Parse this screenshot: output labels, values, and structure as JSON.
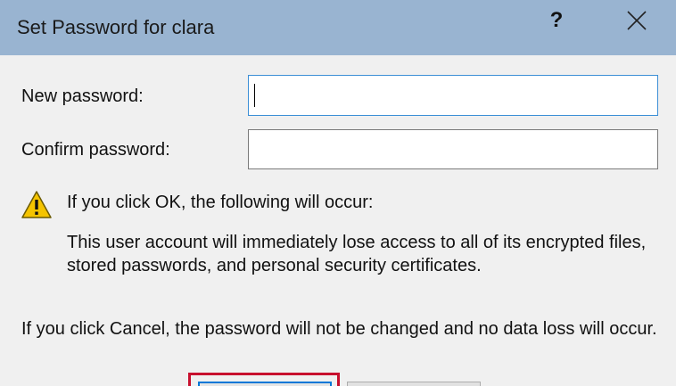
{
  "window": {
    "title": "Set Password for clara",
    "help_label": "?"
  },
  "form": {
    "new_password_label": "New password:",
    "new_password_value": "",
    "confirm_password_label": "Confirm password:",
    "confirm_password_value": ""
  },
  "warning": {
    "heading": "If you click OK, the following will occur:",
    "detail": "This user account will immediately lose access to all of its encrypted files, stored passwords, and personal security certificates.",
    "cancel_note": "If you click Cancel, the password will not be changed and no data loss will occur.",
    "icon": "warning-triangle-icon"
  },
  "buttons": {
    "ok_label": "",
    "cancel_label": ""
  },
  "colors": {
    "titlebar": "#99b4d1",
    "dialog_bg": "#f0f0f0",
    "focus_border": "#3c8fd6",
    "highlight": "#c8102e",
    "warning_fill": "#f5c400"
  }
}
